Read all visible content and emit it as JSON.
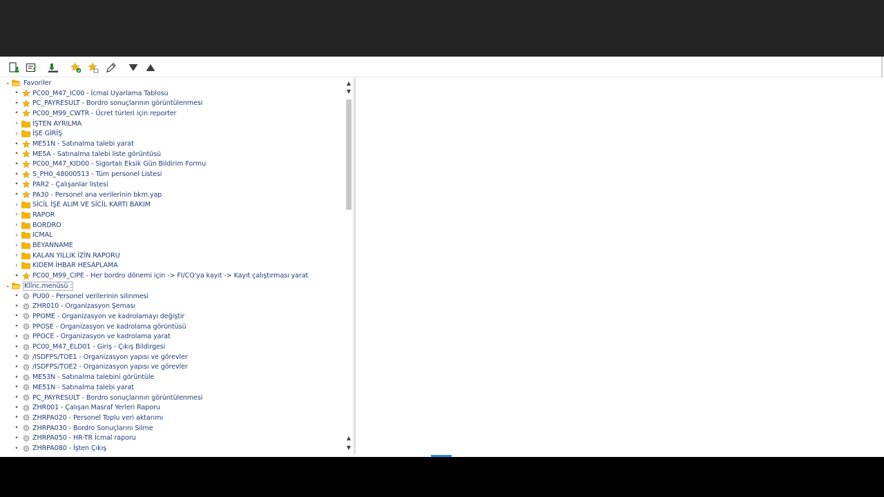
{
  "favorites_root": {
    "label": "Favoriler"
  },
  "favorites": [
    {
      "type": "star",
      "label": "PC00_M47_IC00 - İcmal Uyarlama Tablosu"
    },
    {
      "type": "star",
      "label": "PC_PAYRESULT - Bordro sonuçlarının görüntülenmesi"
    },
    {
      "type": "star",
      "label": "PC00_M99_CWTR - Ücret türleri için reporter"
    },
    {
      "type": "folder",
      "label": "İŞTEN AYRILMA"
    },
    {
      "type": "folder",
      "label": "İŞE GİRİŞ"
    },
    {
      "type": "star",
      "label": "ME51N - Satınalma talebi yarat"
    },
    {
      "type": "star",
      "label": "ME5A - Satınalma talebi liste görüntüsü"
    },
    {
      "type": "star",
      "label": "PC00_M47_KID00 - Sigortalı Eksik Gün Bildirim Formu"
    },
    {
      "type": "star",
      "label": "S_PH0_48000513 - Tüm personel Listesi"
    },
    {
      "type": "star",
      "label": "PAR2 - Çalışanlar listesi"
    },
    {
      "type": "star",
      "label": "PA30 - Personel ana verilerinin bkm.yap"
    },
    {
      "type": "folder",
      "label": "SİCİL İŞE ALIM VE SİCİL KARTI BAKIM"
    },
    {
      "type": "folder",
      "label": "RAPOR"
    },
    {
      "type": "folder",
      "label": "BORDRO"
    },
    {
      "type": "folder",
      "label": "ICMAL"
    },
    {
      "type": "folder",
      "label": "BEYANNAME"
    },
    {
      "type": "folder",
      "label": "KALAN YILLIK İZİN RAPORU"
    },
    {
      "type": "folder",
      "label": "KIDEM İHBAR HESAPLAMA"
    },
    {
      "type": "star",
      "label": "PC00_M99_CIPE - Her bordro dönemi için -> FI/CO'ya kayıt -> Kayıt çalıştırması yarat"
    }
  ],
  "user_menu_root": {
    "label": "Kllnc.menüsü :"
  },
  "user_menu": [
    {
      "label": "PU00 - Personel verilerinin silinmesi"
    },
    {
      "label": "ZHR010 - Organizasyon Şeması"
    },
    {
      "label": "PPOME - Organizasyon ve kadrolamayı değiştir"
    },
    {
      "label": "PPOSE - Organizasyon ve kadrolama görüntüsü"
    },
    {
      "label": "PPOCE - Organizasyon ve kadrolama yarat"
    },
    {
      "label": "PC00_M47_ELD01 - Giriş - Çıkış Bildirgesi"
    },
    {
      "label": "/ISDFPS/TOE1 - Organizasyon yapısı ve görevler"
    },
    {
      "label": "/ISDFPS/TOE2 - Organizasyon yapısı ve görevler"
    },
    {
      "label": "ME53N - Satınalma talebini görüntüle"
    },
    {
      "label": "ME51N - Satınalma talebi yarat"
    },
    {
      "label": "PC_PAYRESULT - Bordro sonuçlarının görüntülenmesi"
    },
    {
      "label": "ZHR001 - Çalışan Masraf Yerleri Raporu"
    },
    {
      "label": "ZHRPA020 - Personel Toplu veri aktarımı"
    },
    {
      "label": "ZHRPA030 - Bordro Sonuçlarını Silme"
    },
    {
      "label": "ZHRPA050 - HR-TR İcmal raporu"
    },
    {
      "label": "ZHRPA080 - İşten Çıkış"
    }
  ],
  "icons": {
    "toolbar": [
      "user-menu-icon",
      "sap-menu-icon",
      "other-menu-icon",
      "add-favorite-icon",
      "insert-favorite-icon",
      "edit-icon",
      "move-down-icon",
      "move-up-icon"
    ],
    "star_color": "#f2b617",
    "folder_color": "#f5b400"
  }
}
